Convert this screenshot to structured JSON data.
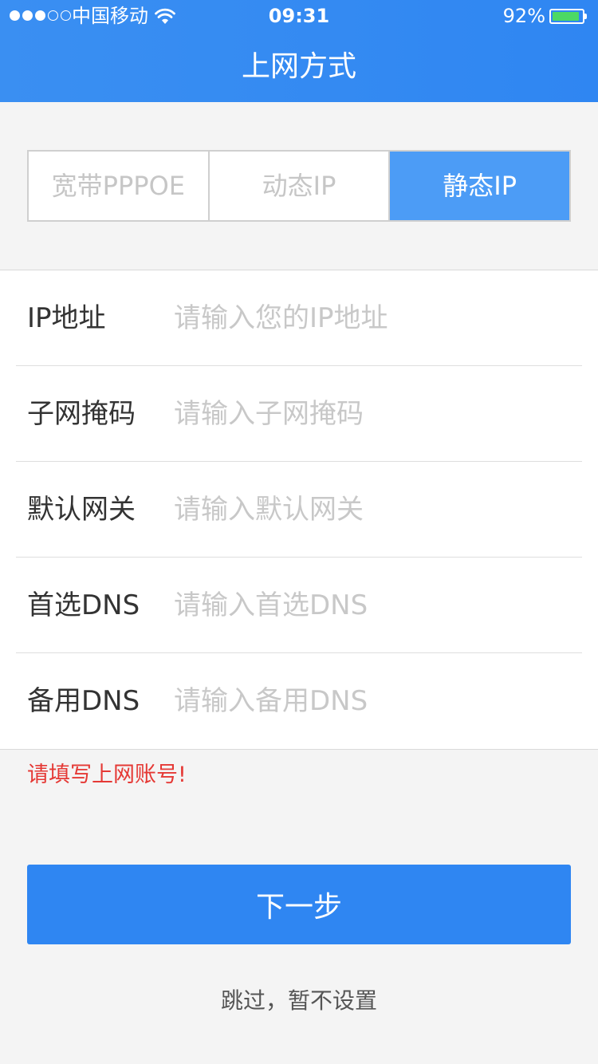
{
  "status_bar": {
    "carrier": "中国移动",
    "time": "09:31",
    "battery": "92%",
    "battery_level": 0.92,
    "signal_bars_filled": 3,
    "signal_bars_total": 5
  },
  "header": {
    "title": "上网方式"
  },
  "tabs": [
    {
      "label": "宽带PPPOE",
      "active": false
    },
    {
      "label": "动态IP",
      "active": false
    },
    {
      "label": "静态IP",
      "active": true
    }
  ],
  "form": {
    "fields": [
      {
        "label": "IP地址",
        "placeholder": "请输入您的IP地址",
        "value": ""
      },
      {
        "label": "子网掩码",
        "placeholder": "请输入子网掩码",
        "value": ""
      },
      {
        "label": "默认网关",
        "placeholder": "请输入默认网关",
        "value": ""
      },
      {
        "label": "首选DNS",
        "placeholder": "请输入首选DNS",
        "value": ""
      },
      {
        "label": "备用DNS",
        "placeholder": "请输入备用DNS",
        "value": ""
      }
    ]
  },
  "error_message": "请填写上网账号!",
  "actions": {
    "next_label": "下一步",
    "skip_label": "跳过，暂不设置"
  },
  "colors": {
    "header_blue": "#2f86f2",
    "active_tab": "#4c9cf6",
    "error_red": "#e53935",
    "battery_green": "#4cd964"
  }
}
